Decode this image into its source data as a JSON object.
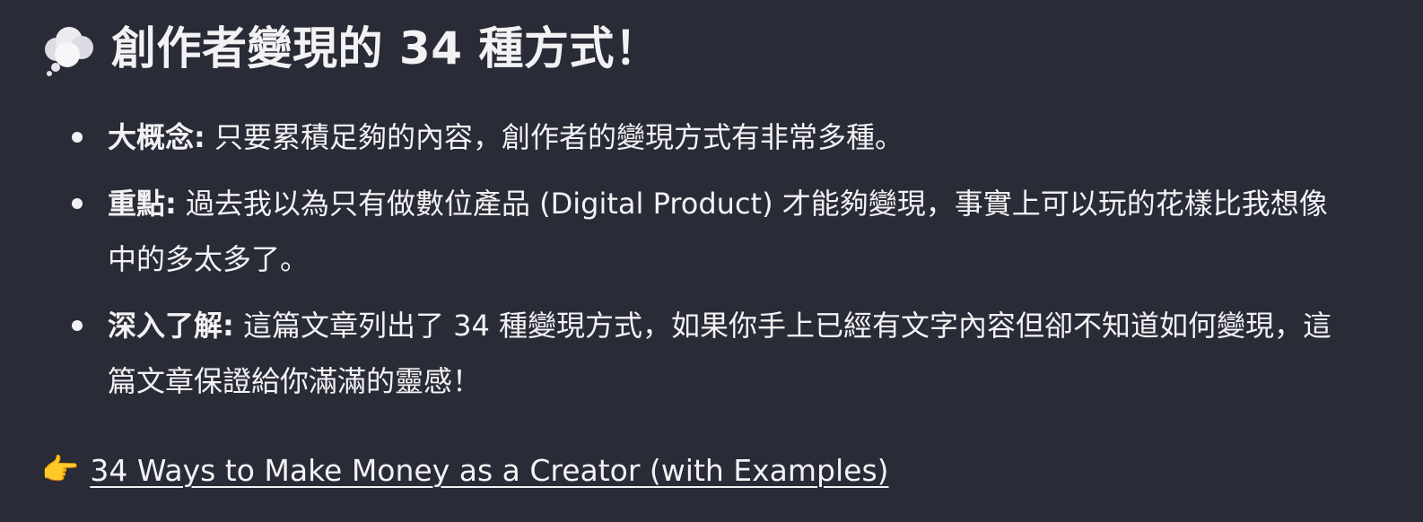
{
  "title": {
    "icon": "thought-balloon-icon",
    "text": "創作者變現的 34 種方式！"
  },
  "points": [
    {
      "term": "大概念:",
      "text": "只要累積足夠的內容，創作者的變現方式有非常多種。"
    },
    {
      "term": "重點:",
      "text": "過去我以為只有做數位產品 (Digital Product) 才能夠變現，事實上可以玩的花樣比我想像中的多太多了。"
    },
    {
      "term": "深入了解:",
      "text": "這篇文章列出了 34 種變現方式，如果你手上已經有文字內容但卻不知道如何變現，這篇文章保證給你滿滿的靈感！"
    }
  ],
  "link": {
    "icon": "pointing-hand-icon",
    "icon_glyph": "👉",
    "text": "34 Ways to Make Money as a Creator (with Examples)"
  }
}
